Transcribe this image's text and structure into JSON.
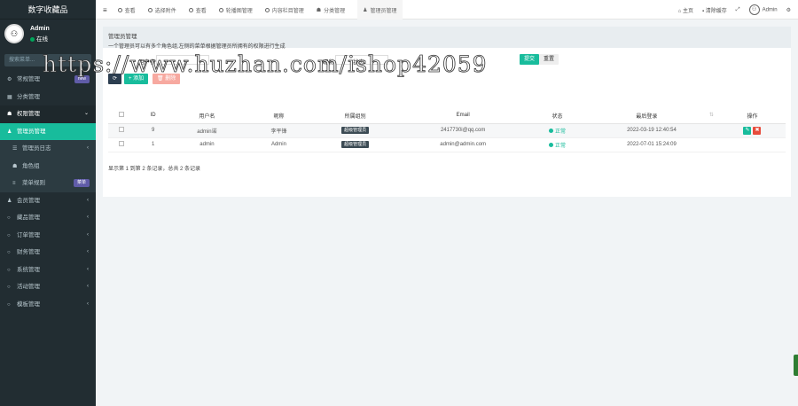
{
  "sidebar": {
    "brand": "数字收藏品",
    "user": {
      "name": "Admin",
      "status": "在线"
    },
    "search_placeholder": "搜索菜单...",
    "items": [
      {
        "label": "常规管理",
        "icon": "gear-icon",
        "badge": "new",
        "badge_color": "#605ca8"
      },
      {
        "label": "分类管理",
        "icon": "grid-icon"
      },
      {
        "label": "权限管理",
        "icon": "group-icon",
        "arrow": "⌄"
      },
      {
        "label": "管理员管理",
        "icon": "user-icon",
        "active": true
      },
      {
        "label": "管理员日志",
        "icon": "list-icon",
        "arrow": "‹"
      },
      {
        "label": "角色组",
        "icon": "group-icon"
      },
      {
        "label": "菜单规则",
        "icon": "bars-icon",
        "badge": "菜单",
        "badge_color": "#605ca8"
      },
      {
        "label": "会员管理",
        "icon": "user-icon",
        "arrow": "‹"
      },
      {
        "label": "藏品管理",
        "icon": "circle-icon",
        "arrow": "‹"
      },
      {
        "label": "订单管理",
        "icon": "circle-icon",
        "arrow": "‹"
      },
      {
        "label": "财务管理",
        "icon": "circle-icon",
        "arrow": "‹"
      },
      {
        "label": "系统管理",
        "icon": "circle-icon",
        "arrow": "‹"
      },
      {
        "label": "活动管理",
        "icon": "circle-icon",
        "arrow": "‹"
      },
      {
        "label": "模板管理",
        "icon": "circle-icon",
        "arrow": "‹"
      }
    ]
  },
  "navbar": {
    "tabs": [
      "查看",
      "选择附件",
      "查看",
      "轮播图管理",
      "内容栏目管理",
      "分类管理",
      "管理员管理"
    ],
    "right": {
      "home": "主页",
      "clear": "清除缓存",
      "user": "Admin"
    }
  },
  "panel": {
    "title": "管理员管理",
    "description": "一个管理员可以有多个角色组,左侧的菜单根据管理员所拥有的权限进行生成"
  },
  "filter": {
    "label1": "用户名",
    "label2": "昵称",
    "label3": "状态",
    "submit": "提交",
    "reset": "重置"
  },
  "toolbar": {
    "refresh": "⟳",
    "add": "+ 添加",
    "delete": "🗑 删除"
  },
  "table": {
    "columns": [
      "ID",
      "用户名",
      "昵称",
      "所属组别",
      "Email",
      "状态",
      "最后登录",
      "操作"
    ],
    "rows": [
      {
        "id": "9",
        "username": "admin诺",
        "nickname": "李平锋",
        "group": "超级管理员",
        "email": "2417730i@qq.com",
        "status": "正常",
        "last_login": "2022-03-19 12:40:54"
      },
      {
        "id": "1",
        "username": "admin",
        "nickname": "Admin",
        "group": "超级管理员",
        "email": "admin@admin.com",
        "status": "正常",
        "last_login": "2022-07-01 15:24:09"
      }
    ]
  },
  "pager": "显示第 1 到第 2 条记录，总共 2 条记录",
  "watermark": "https://www.huzhan.com/ishop42059"
}
